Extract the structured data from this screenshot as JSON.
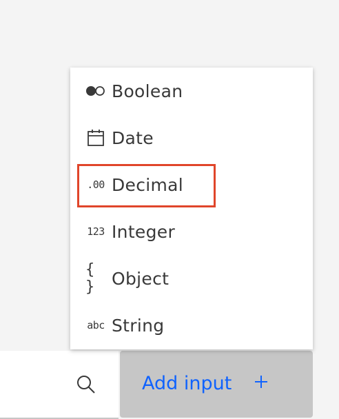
{
  "menu": {
    "items": [
      {
        "label": "Boolean",
        "icon": "boolean-toggle-icon"
      },
      {
        "label": "Date",
        "icon": "calendar-icon"
      },
      {
        "label": "Decimal",
        "icon_text": ".00",
        "icon": "decimal-icon"
      },
      {
        "label": "Integer",
        "icon_text": "123",
        "icon": "integer-icon"
      },
      {
        "label": "Object",
        "icon_text": "{ }",
        "icon": "object-braces-icon"
      },
      {
        "label": "String",
        "icon_text": "abc",
        "icon": "string-icon"
      }
    ],
    "highlighted_item": "Decimal"
  },
  "search": {
    "icon": "search-icon"
  },
  "add_input_button": {
    "label": "Add input",
    "icon": "plus-icon"
  },
  "colors": {
    "page_background": "#f4f4f4",
    "menu_background": "#ffffff",
    "text": "#393939",
    "link_blue": "#0f62fe",
    "button_background": "#c6c6c6",
    "highlight_border": "#e0452a"
  }
}
